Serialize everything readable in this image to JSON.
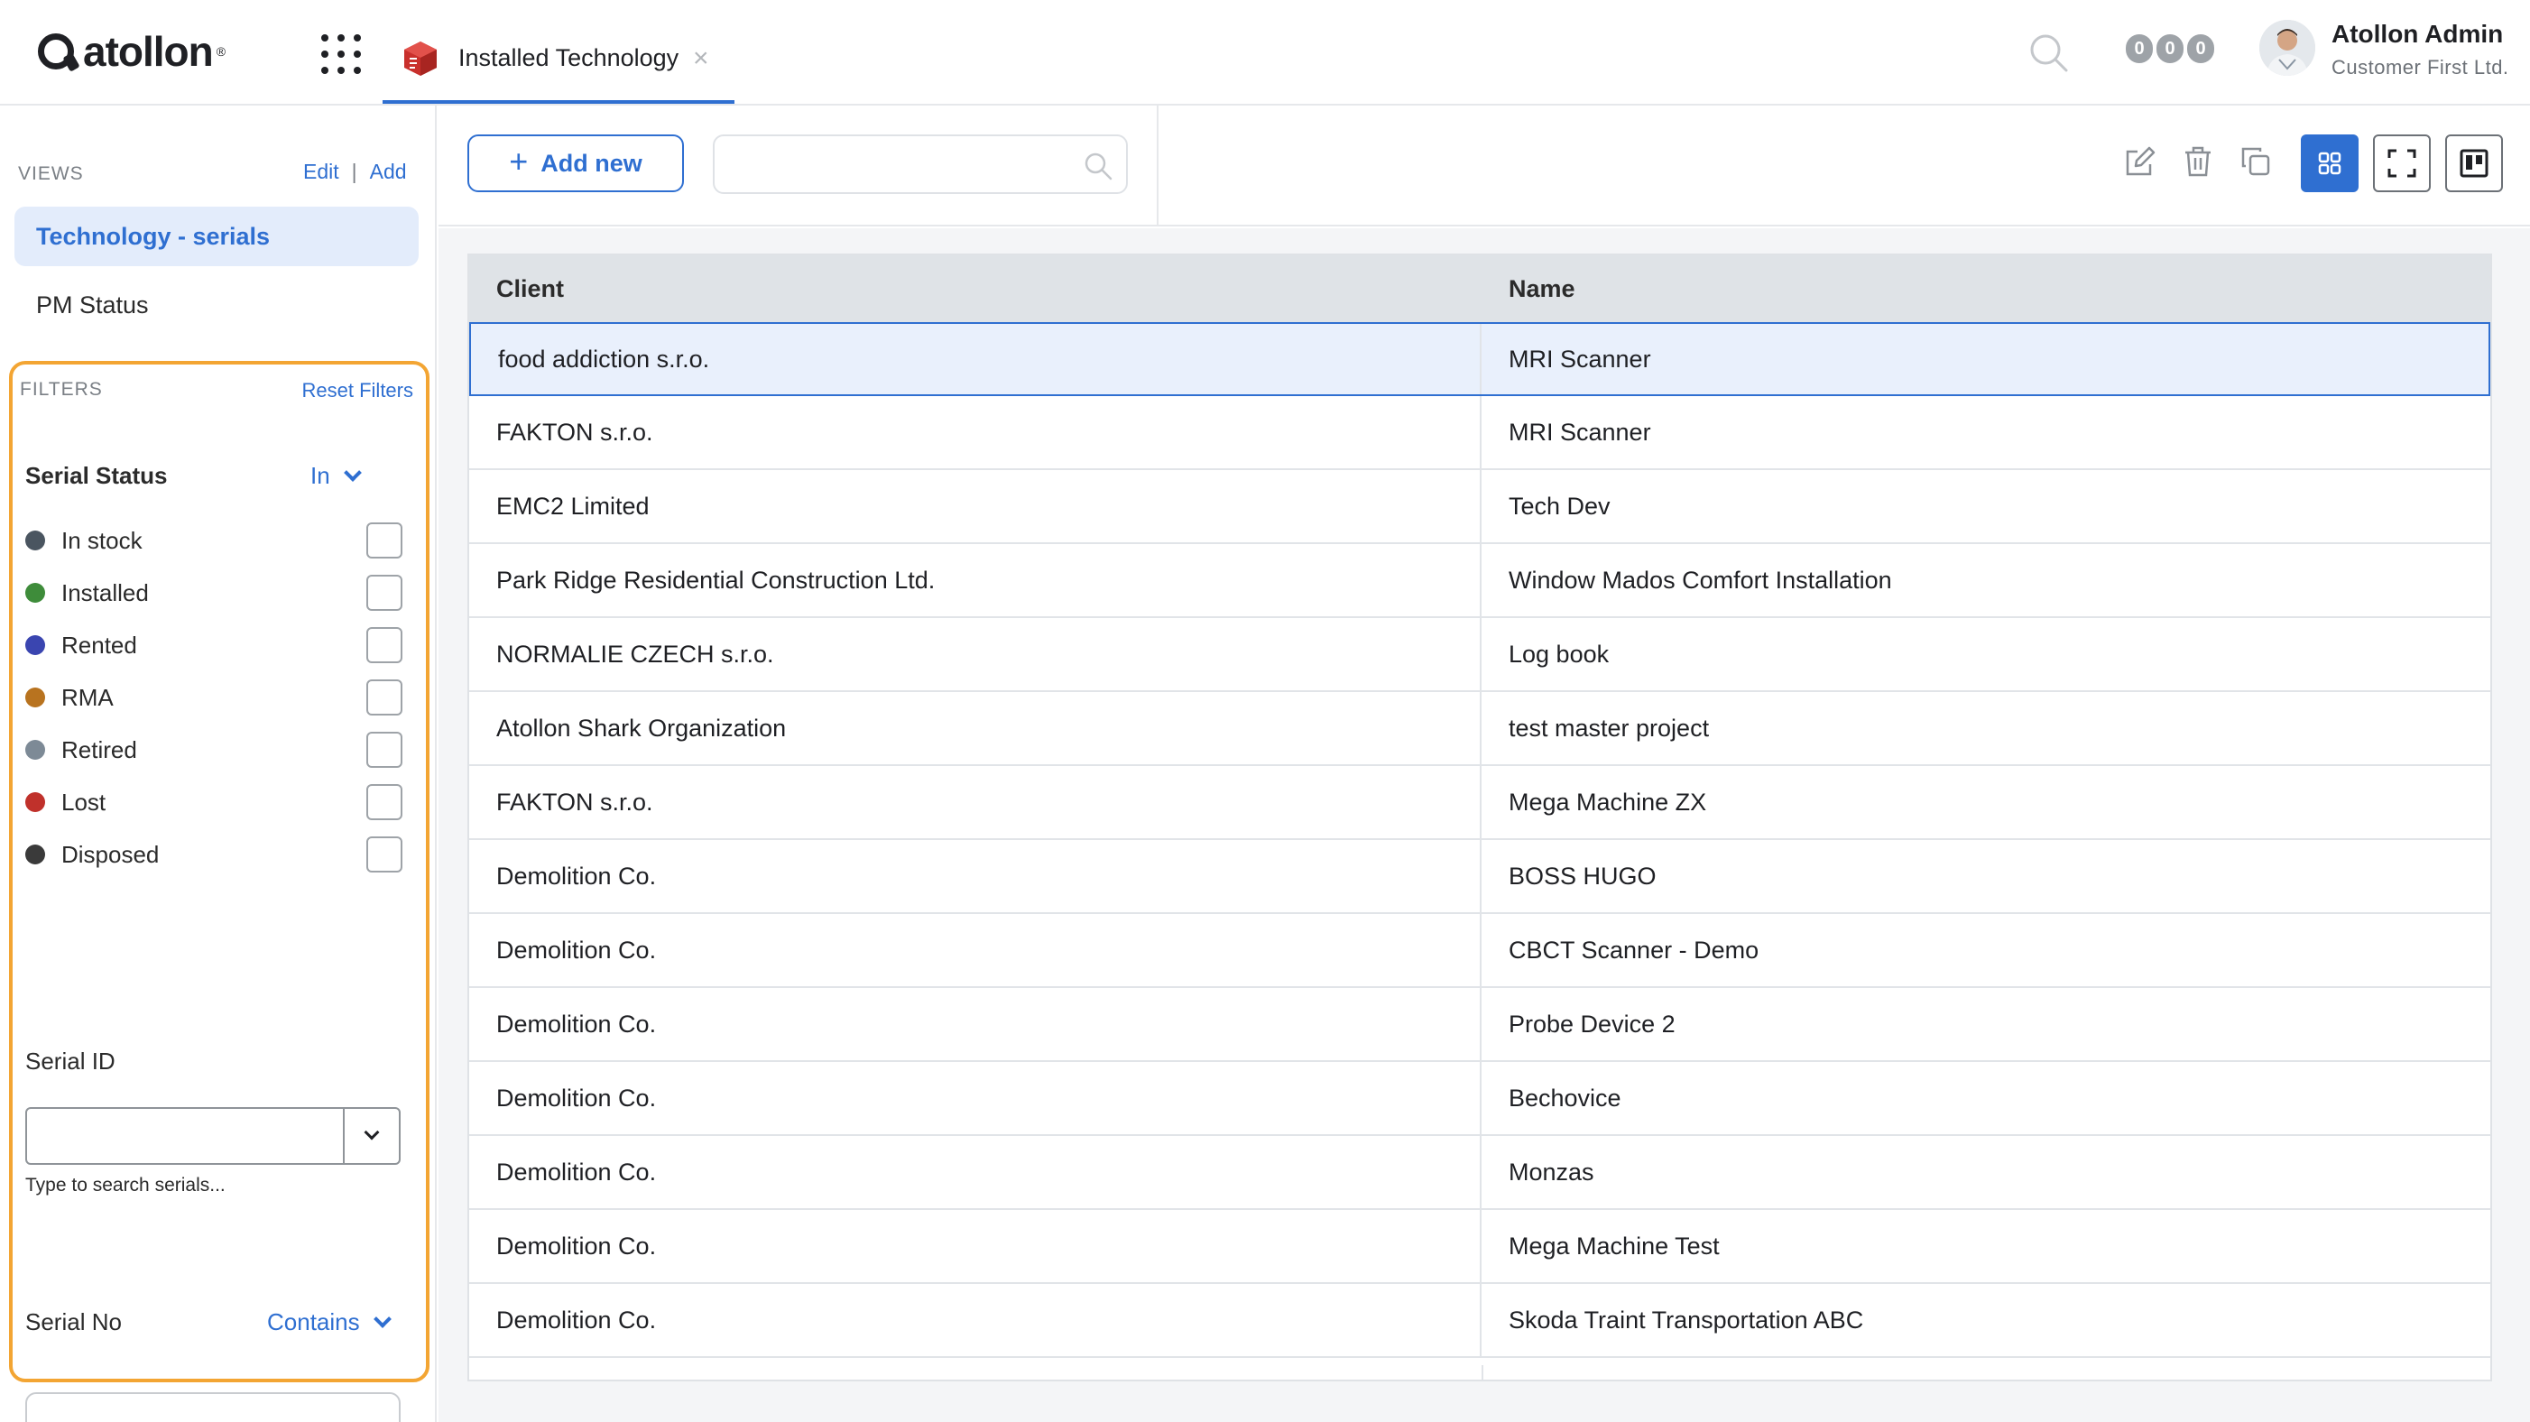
{
  "app": {
    "logo_text": "atollon",
    "logo_reg": "®",
    "tab_label": "Installed Technology",
    "tab_close": "×",
    "notification_counts": [
      "0",
      "0",
      "0"
    ],
    "user_name": "Atollon Admin",
    "user_org": "Customer First Ltd."
  },
  "sidebar": {
    "views_title": "VIEWS",
    "edit_label": "Edit",
    "add_label": "Add",
    "separator": "|",
    "views": [
      {
        "label": "Technology - serials",
        "active": true
      },
      {
        "label": "PM Status",
        "active": false
      }
    ],
    "filters_title": "FILTERS",
    "reset_label": "Reset Filters",
    "serial_status": {
      "label": "Serial Status",
      "operator": "In",
      "options": [
        {
          "label": "In stock",
          "color": "#4a5560",
          "checked": false
        },
        {
          "label": "Installed",
          "color": "#3e8c3a",
          "checked": false
        },
        {
          "label": "Rented",
          "color": "#3a45b0",
          "checked": false
        },
        {
          "label": "RMA",
          "color": "#b8731f",
          "checked": false
        },
        {
          "label": "Retired",
          "color": "#7d8a96",
          "checked": false
        },
        {
          "label": "Lost",
          "color": "#c0312b",
          "checked": false
        },
        {
          "label": "Disposed",
          "color": "#3a3a3a",
          "checked": false
        }
      ]
    },
    "serial_id": {
      "label": "Serial ID",
      "value": "",
      "hint": "Type to search serials..."
    },
    "serial_no": {
      "label": "Serial No",
      "operator": "Contains",
      "value": ""
    }
  },
  "toolbar": {
    "add_label": "Add new",
    "add_plus": "+",
    "search_value": "",
    "icons": [
      "edit-icon",
      "trash-icon",
      "duplicate-icon",
      "grid-view-icon",
      "fullscreen-icon",
      "kanban-icon"
    ]
  },
  "table": {
    "columns": [
      "Client",
      "Name"
    ],
    "rows": [
      {
        "client": "food addiction s.r.o.",
        "name": "MRI Scanner",
        "selected": true
      },
      {
        "client": "FAKTON s.r.o.",
        "name": "MRI Scanner"
      },
      {
        "client": "EMC2 Limited",
        "name": "Tech Dev"
      },
      {
        "client": "Park Ridge Residential Construction Ltd.",
        "name": "Window Mados Comfort Installation"
      },
      {
        "client": "NORMALIE CZECH s.r.o.",
        "name": "Log book"
      },
      {
        "client": "Atollon Shark Organization",
        "name": "test master project"
      },
      {
        "client": "FAKTON s.r.o.",
        "name": "Mega Machine ZX"
      },
      {
        "client": "Demolition Co.",
        "name": "BOSS HUGO"
      },
      {
        "client": "Demolition Co.",
        "name": "CBCT Scanner - Demo"
      },
      {
        "client": "Demolition Co.",
        "name": "Probe Device 2"
      },
      {
        "client": "Demolition Co.",
        "name": "Bechovice"
      },
      {
        "client": "Demolition Co.",
        "name": "Monzas"
      },
      {
        "client": "Demolition Co.",
        "name": "Mega Machine Test"
      },
      {
        "client": "Demolition Co.",
        "name": "Skoda Traint Transportation ABC"
      }
    ]
  },
  "colors": {
    "accent": "#2f6fd1",
    "filter_highlight": "#f3a533",
    "selected_row_bg": "#e9f0fc",
    "header_bg": "#dfe3e7"
  }
}
